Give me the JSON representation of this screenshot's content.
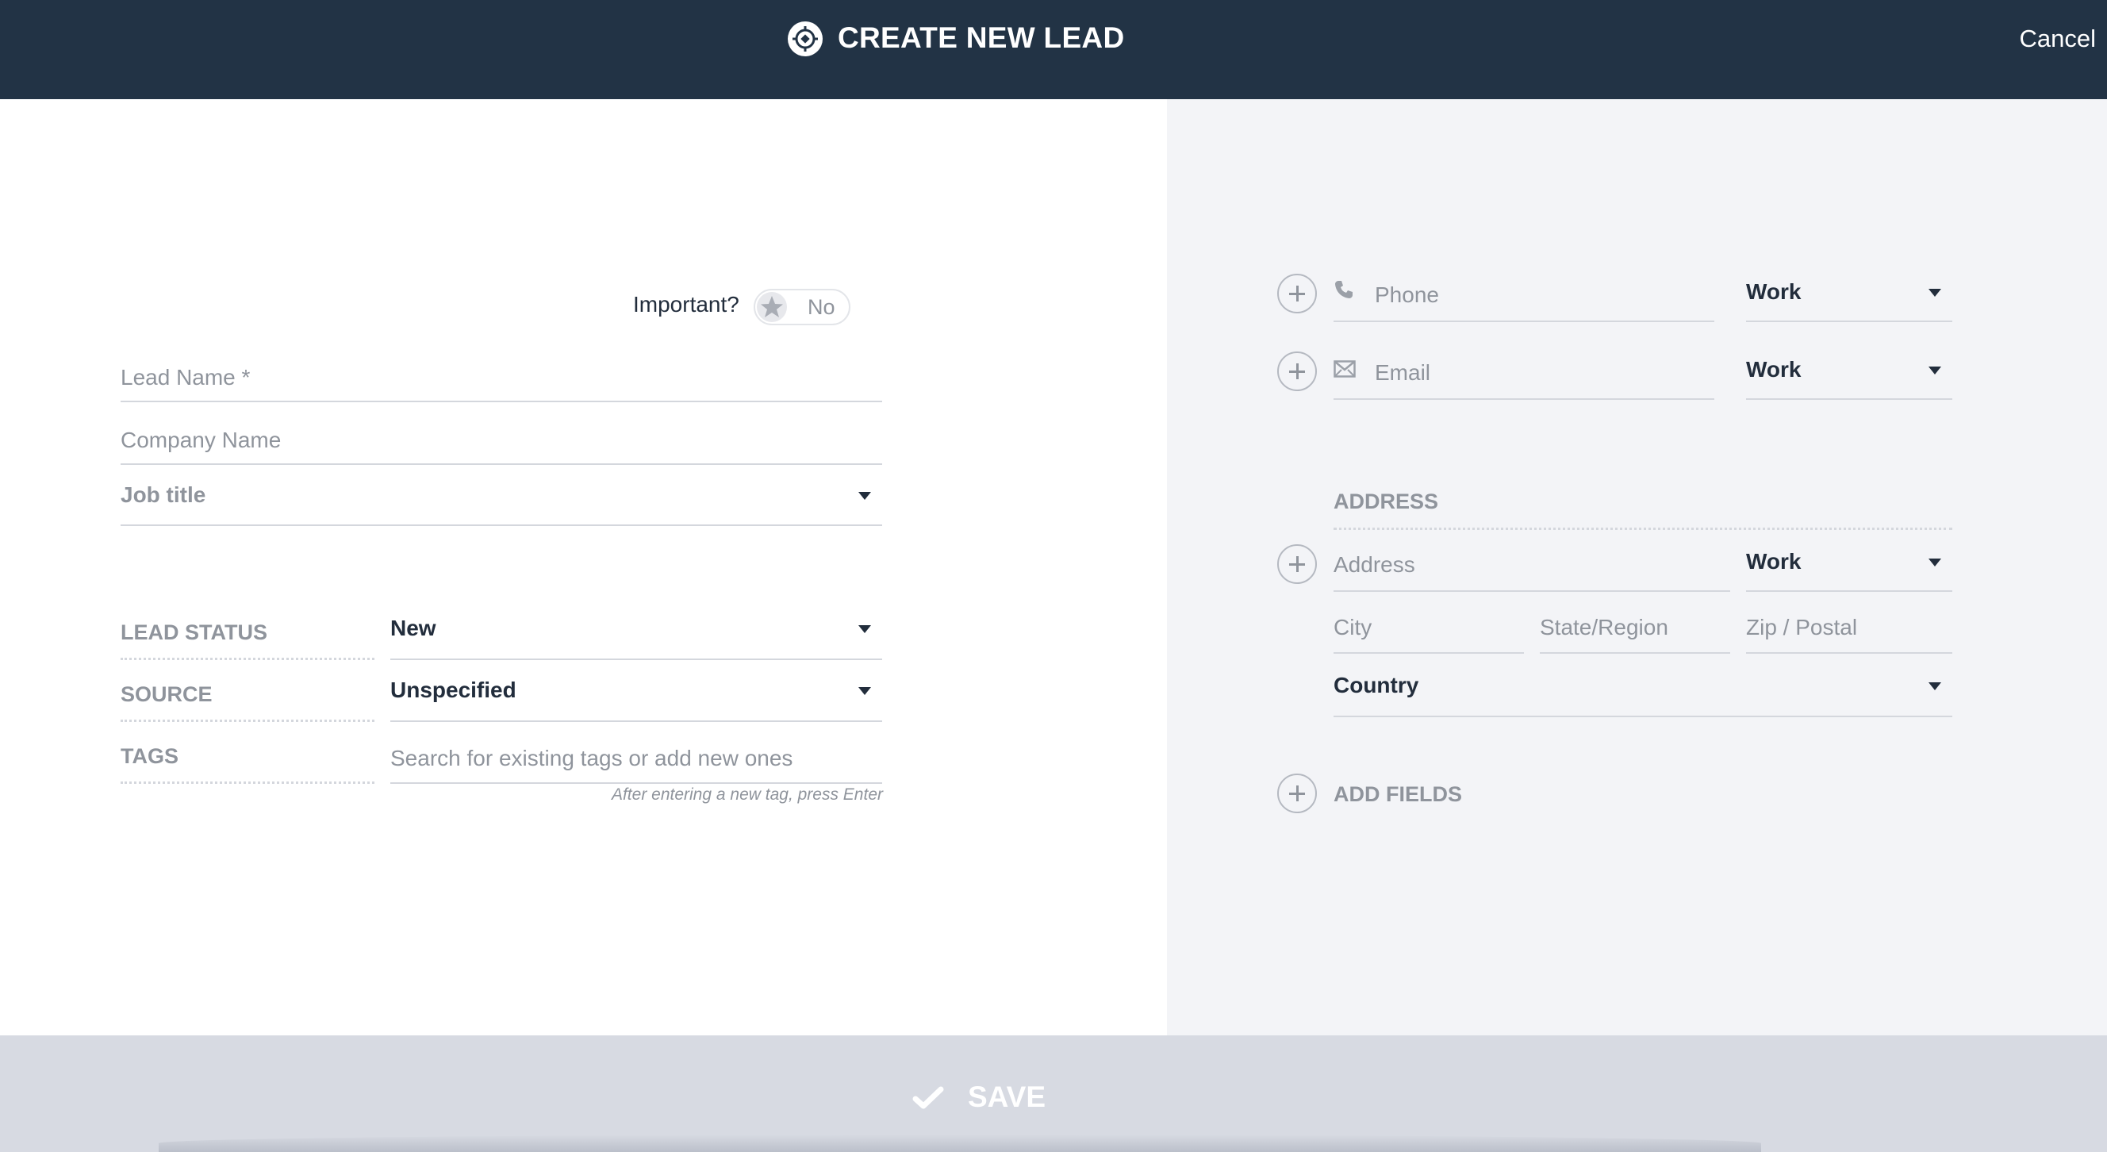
{
  "header": {
    "title": "CREATE NEW LEAD",
    "cancel_label": "Cancel",
    "brand_icon": "crosshair-circle-icon"
  },
  "colors": {
    "header_bg": "#223345",
    "right_panel_bg": "#f3f4f7",
    "footer_bg": "#d7dae2",
    "text_dark": "#222d3c",
    "text_muted": "#8f949c"
  },
  "left": {
    "important": {
      "label": "Important?",
      "toggle_text": "No",
      "icon": "star-icon"
    },
    "lead_name": {
      "placeholder": "Lead Name *",
      "value": ""
    },
    "company_name": {
      "placeholder": "Company Name",
      "value": ""
    },
    "job_title": {
      "placeholder": "Job title"
    },
    "lead_status": {
      "label": "LEAD STATUS",
      "value": "New"
    },
    "source": {
      "label": "SOURCE",
      "value": "Unspecified"
    },
    "tags": {
      "label": "TAGS",
      "placeholder": "Search for existing tags or add new ones",
      "hint": "After entering a new tag, press Enter"
    }
  },
  "right": {
    "phone": {
      "placeholder": "Phone",
      "type": "Work",
      "icon": "phone-icon"
    },
    "email": {
      "placeholder": "Email",
      "type": "Work",
      "icon": "envelope-icon"
    },
    "address_section": {
      "heading": "ADDRESS",
      "address_placeholder": "Address",
      "type": "Work",
      "city_placeholder": "City",
      "state_placeholder": "State/Region",
      "zip_placeholder": "Zip / Postal",
      "country": "Country"
    },
    "add_fields_label": "ADD FIELDS"
  },
  "footer": {
    "save_label": "SAVE",
    "icon": "checkmark-icon"
  }
}
